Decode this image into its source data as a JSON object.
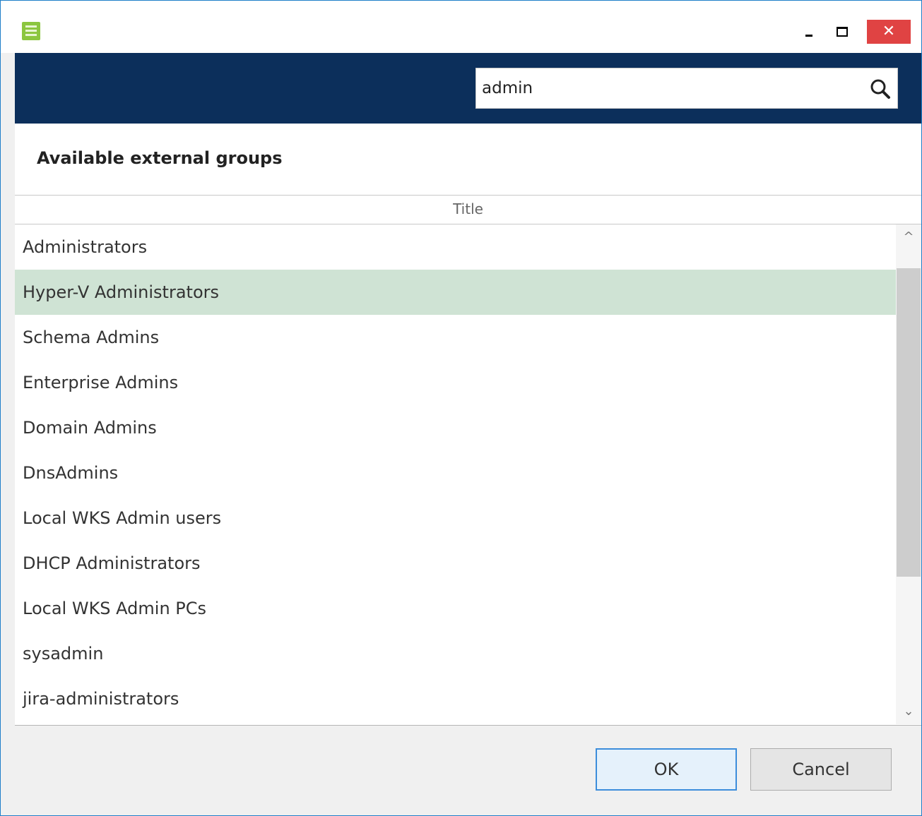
{
  "window": {
    "app_icon": "list-app-icon",
    "controls": {
      "minimize_icon": "minimize-icon",
      "maximize_icon": "maximize-icon",
      "close_label": "✕"
    }
  },
  "search": {
    "value": "admin",
    "icon": "search-icon"
  },
  "section": {
    "title": "Available external groups"
  },
  "table": {
    "column_header": "Title",
    "selected_index": 1,
    "rows": [
      "Administrators",
      "Hyper-V Administrators",
      "Schema Admins",
      "Enterprise Admins",
      "Domain Admins",
      "DnsAdmins",
      "Local WKS Admin users",
      "DHCP Administrators",
      "Local WKS Admin PCs",
      "sysadmin",
      "jira-administrators"
    ]
  },
  "scrollbar": {
    "up_arrow": "^",
    "down_arrow": "⌄"
  },
  "buttons": {
    "ok": "OK",
    "cancel": "Cancel"
  },
  "colors": {
    "header_bg": "#0c2f5b",
    "selected_row": "#cfe3d4",
    "close_button": "#e04343",
    "app_icon": "#8cc63f"
  }
}
